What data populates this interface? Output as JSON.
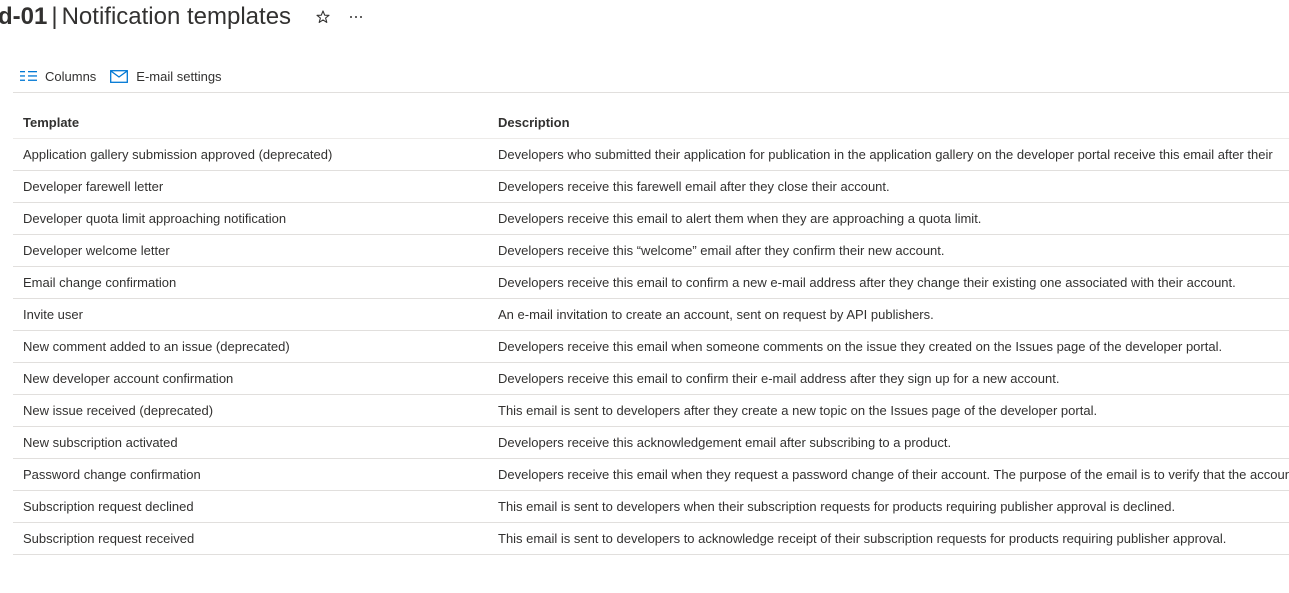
{
  "header": {
    "resource_name": "d-01",
    "separator": "|",
    "page_title": "Notification templates"
  },
  "toolbar": {
    "columns_label": "Columns",
    "email_settings_label": "E-mail settings"
  },
  "table": {
    "headers": {
      "template": "Template",
      "description": "Description"
    },
    "rows": [
      {
        "template": "Application gallery submission approved (deprecated)",
        "description": "Developers who submitted their application for publication in the application gallery on the developer portal receive this email after their"
      },
      {
        "template": "Developer farewell letter",
        "description": "Developers receive this farewell email after they close their account."
      },
      {
        "template": "Developer quota limit approaching notification",
        "description": "Developers receive this email to alert them when they are approaching a quota limit."
      },
      {
        "template": "Developer welcome letter",
        "description": "Developers receive this “welcome” email after they confirm their new account."
      },
      {
        "template": "Email change confirmation",
        "description": "Developers receive this email to confirm a new e-mail address after they change their existing one associated with their account."
      },
      {
        "template": "Invite user",
        "description": "An e-mail invitation to create an account, sent on request by API publishers."
      },
      {
        "template": "New comment added to an issue (deprecated)",
        "description": "Developers receive this email when someone comments on the issue they created on the Issues page of the developer portal."
      },
      {
        "template": "New developer account confirmation",
        "description": "Developers receive this email to confirm their e-mail address after they sign up for a new account."
      },
      {
        "template": "New issue received (deprecated)",
        "description": "This email is sent to developers after they create a new topic on the Issues page of the developer portal."
      },
      {
        "template": "New subscription activated",
        "description": "Developers receive this acknowledgement email after subscribing to a product."
      },
      {
        "template": "Password change confirmation",
        "description": "Developers receive this email when they request a password change of their account. The purpose of the email is to verify that the account"
      },
      {
        "template": "Subscription request declined",
        "description": "This email is sent to developers when their subscription requests for products requiring publisher approval is declined."
      },
      {
        "template": "Subscription request received",
        "description": "This email is sent to developers to acknowledge receipt of their subscription requests for products requiring publisher approval."
      }
    ]
  },
  "icons": {
    "favorite": "star-outline-icon",
    "more": "ellipsis-icon",
    "columns": "columns-icon",
    "email": "mail-icon"
  },
  "colors": {
    "accent": "#0078d4",
    "text": "#323130",
    "divider": "#e1dfdd"
  }
}
